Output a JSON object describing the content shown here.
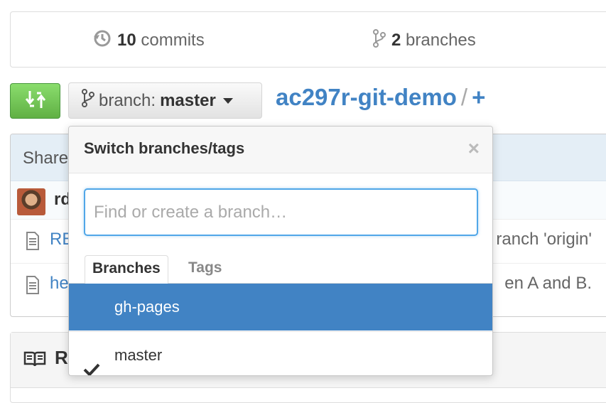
{
  "stats": {
    "commits_count": "10",
    "commits_label": "commits",
    "branches_count": "2",
    "branches_label": "branches"
  },
  "branch_selector": {
    "prefix": "branch:",
    "current": "master"
  },
  "repo": {
    "name": "ac297r-git-demo",
    "separator": "/",
    "add": "+"
  },
  "file_browser": {
    "header_text": "Share",
    "commit_author_partial": "rd",
    "files": [
      {
        "name_partial": "RE",
        "message_partial": "ranch 'origin'"
      },
      {
        "name_partial": "he",
        "message_partial": "en A and B."
      }
    ],
    "readme_title_partial": "R"
  },
  "dropdown": {
    "title": "Switch branches/tags",
    "close_symbol": "×",
    "search_placeholder": "Find or create a branch…",
    "tabs": [
      "Branches",
      "Tags"
    ],
    "branches": [
      {
        "name": "gh-pages",
        "selected": false,
        "highlighted": true
      },
      {
        "name": "master",
        "selected": true,
        "highlighted": false
      }
    ]
  },
  "colors": {
    "link": "#4183c4",
    "highlight": "#4183c4",
    "compare_button": "#6cc644",
    "focus_border": "#51a7e8"
  },
  "icons": [
    "history-icon",
    "branch-icon",
    "compare-icon",
    "file-icon",
    "book-icon",
    "check-icon"
  ]
}
